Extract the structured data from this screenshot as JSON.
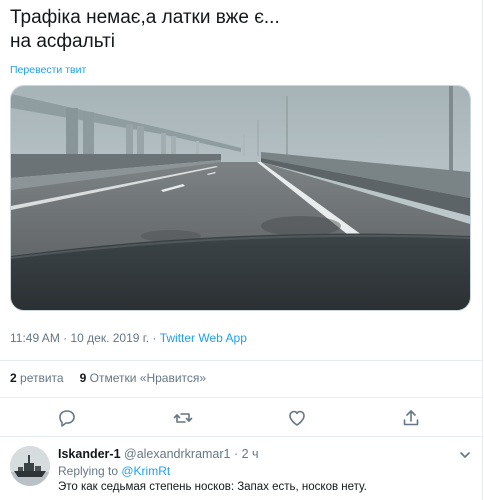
{
  "tweet": {
    "text": "Трафіка немає,а латки вже є...\nна асфальті",
    "translate_label": "Перевести твит",
    "media_icon": "bridge-highway-photo",
    "time": "11:49 AM",
    "date": "10 дек. 2019 г.",
    "separator": " · ",
    "app": "Twitter Web App",
    "retweets_count": "2",
    "retweets_label": "ретвита",
    "likes_count": "9",
    "likes_label": "Отметки «Нравится»"
  },
  "actions": {
    "reply_icon": "reply-icon",
    "retweet_icon": "retweet-icon",
    "like_icon": "like-icon",
    "share_icon": "share-icon"
  },
  "reply": {
    "name": "Iskander-1",
    "handle": "@alexandrkramar1",
    "separator": " · ",
    "time": "2 ч",
    "replying_prefix": "Replying to ",
    "replying_to": "@KrimRt",
    "text": "Это как седьмая степень носков: Запах есть, носков нету."
  },
  "colors": {
    "accent": "#1da1f2",
    "muted": "#657786",
    "border": "#e6ecf0",
    "text": "#14171a"
  }
}
